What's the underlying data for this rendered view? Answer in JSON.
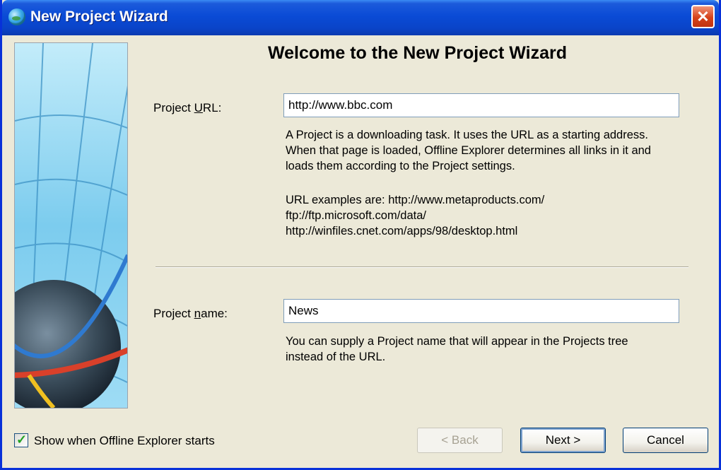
{
  "window": {
    "title": "New Project Wizard"
  },
  "heading": "Welcome to the New Project Wizard",
  "project_url": {
    "label_before": "Project ",
    "label_underlined": "U",
    "label_after": "RL:",
    "value": "http://www.bbc.com",
    "description": [
      "A Project is a downloading task. It uses the URL as a starting address.",
      "When that page is loaded, Offline Explorer determines all links in it and",
      "loads them according to the Project settings."
    ],
    "examples": [
      "URL examples are: http://www.metaproducts.com/",
      "ftp://ftp.microsoft.com/data/",
      "http://winfiles.cnet.com/apps/98/desktop.html"
    ]
  },
  "project_name": {
    "label_before": "Project ",
    "label_underlined": "n",
    "label_after": "ame:",
    "value": "News",
    "description": [
      "You can supply a Project name that will appear in the Projects tree",
      "instead of the URL."
    ]
  },
  "footer": {
    "checkbox_label": "Show when Offline Explorer starts",
    "checkbox_checked": true,
    "back_label": "< Back",
    "next_label": "Next >",
    "cancel_label": "Cancel"
  },
  "colors": {
    "titlebar": "#0A4BD6",
    "dialog_bg": "#ECE9D8",
    "close_button": "#D5421A"
  },
  "icons": {
    "app": "globe-icon",
    "close": "close-icon",
    "check": "checkmark-icon"
  }
}
